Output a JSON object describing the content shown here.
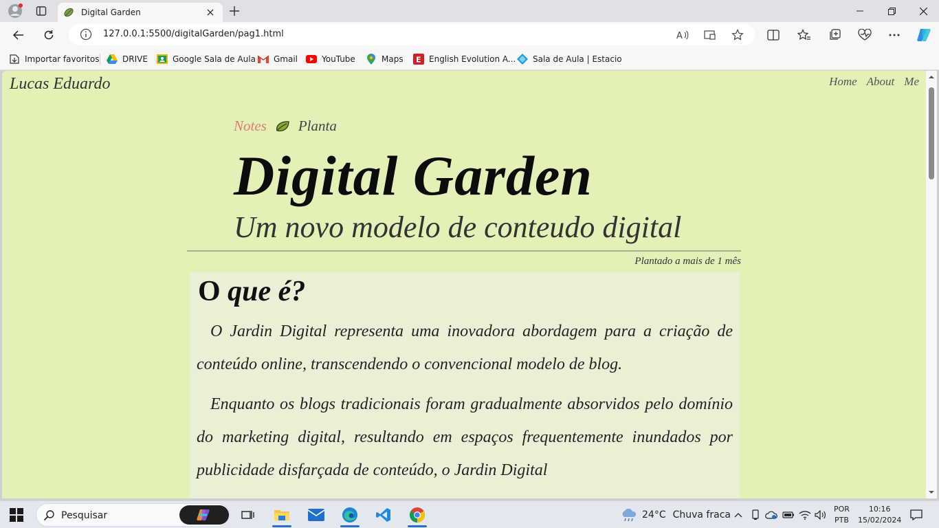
{
  "browser": {
    "tab_title": "Digital Garden",
    "url": "127.0.0.1:5500/digitalGarden/pag1.html",
    "bookmarks": [
      {
        "label": "Importar favoritos",
        "icon": "import-icon"
      },
      {
        "label": "DRIVE",
        "icon": "drive-icon"
      },
      {
        "label": "Google Sala de Aula",
        "icon": "classroom-icon"
      },
      {
        "label": "Gmail",
        "icon": "gmail-icon"
      },
      {
        "label": "YouTube",
        "icon": "youtube-icon"
      },
      {
        "label": "Maps",
        "icon": "maps-icon"
      },
      {
        "label": "English Evolution A...",
        "icon": "english-evolution-icon"
      },
      {
        "label": "Sala de Aula | Estacio",
        "icon": "estacio-icon"
      }
    ]
  },
  "page": {
    "site_name": "Lucas Eduardo",
    "nav": [
      "Home",
      "About",
      "Me"
    ],
    "breadcrumb": {
      "notes": "Notes",
      "stage": "Planta"
    },
    "title": "Digital Garden",
    "subtitle": "Um novo modelo de conteudo digital",
    "planted": "Plantado a mais de 1 mês",
    "section_title_plain": "O ",
    "section_title_italic": "que é?",
    "paragraphs": [
      "O Jardin Digital representa uma inovadora abordagem para a criação de conteúdo online, transcendendo o convencional modelo de blog.",
      "Enquanto os blogs tradicionais foram gradualmente absorvidos pelo domínio do marketing digital, resultando em espaços frequentemente inundados por publicidade disfarçada de conteúdo, o Jardin Digital"
    ]
  },
  "colors": {
    "page_bg": "#e3f0b6",
    "article_bg": "#eaf0d6",
    "notes_accent": "#e07c73"
  },
  "taskbar": {
    "search_placeholder": "Pesquisar",
    "weather_temp": "24°C",
    "weather_desc": "Chuva fraca",
    "lang_line1": "POR",
    "lang_line2": "PTB",
    "time": "10:16",
    "date": "15/02/2024"
  }
}
